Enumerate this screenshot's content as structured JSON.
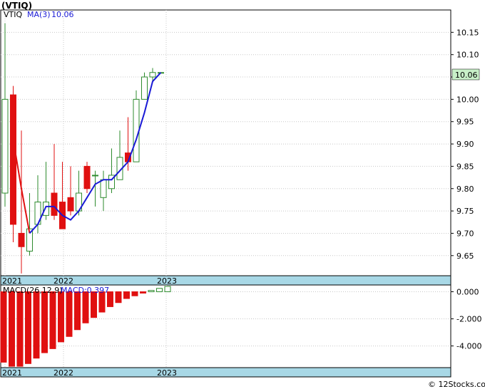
{
  "title": "(VTIQ)",
  "footer": "© 12Stocks.com",
  "colors": {
    "up": "#2e8b2e",
    "down": "#e01010",
    "ma": "#1a1ad6",
    "axis_band": "#a8d8e6",
    "last_price_bg": "#c8f0c8"
  },
  "chart_data": [
    {
      "type": "candlestick",
      "legend": {
        "ticker": "VTIQ",
        "ma_label": "MA(3)",
        "ma_value": "10.06"
      },
      "last_price_label": "10.06",
      "x_tick_labels": [
        "2021",
        "2022",
        "2023"
      ],
      "y_ticks": [
        "9.65",
        "9.70",
        "9.75",
        "9.80",
        "9.85",
        "9.90",
        "9.95",
        "10.00",
        "10.05",
        "10.10",
        "10.15"
      ],
      "ylim": [
        9.605,
        10.2
      ],
      "candles": [
        {
          "o": 9.79,
          "h": 10.17,
          "l": 9.76,
          "c": 10.0
        },
        {
          "o": 10.01,
          "h": 10.03,
          "l": 9.68,
          "c": 9.72
        },
        {
          "o": 9.7,
          "h": 9.93,
          "l": 9.61,
          "c": 9.67
        },
        {
          "o": 9.66,
          "h": 9.79,
          "l": 9.65,
          "c": 9.71
        },
        {
          "o": 9.72,
          "h": 9.83,
          "l": 9.7,
          "c": 9.77
        },
        {
          "o": 9.74,
          "h": 9.86,
          "l": 9.73,
          "c": 9.77
        },
        {
          "o": 9.79,
          "h": 9.9,
          "l": 9.73,
          "c": 9.74
        },
        {
          "o": 9.77,
          "h": 9.86,
          "l": 9.71,
          "c": 9.71
        },
        {
          "o": 9.78,
          "h": 9.85,
          "l": 9.74,
          "c": 9.75
        },
        {
          "o": 9.75,
          "h": 9.84,
          "l": 9.74,
          "c": 9.79
        },
        {
          "o": 9.85,
          "h": 9.86,
          "l": 9.79,
          "c": 9.8
        },
        {
          "o": 9.83,
          "h": 9.84,
          "l": 9.76,
          "c": 9.83
        },
        {
          "o": 9.78,
          "h": 9.84,
          "l": 9.75,
          "c": 9.82
        },
        {
          "o": 9.8,
          "h": 9.89,
          "l": 9.79,
          "c": 9.83
        },
        {
          "o": 9.82,
          "h": 9.93,
          "l": 9.82,
          "c": 9.87
        },
        {
          "o": 9.88,
          "h": 9.96,
          "l": 9.84,
          "c": 9.86
        },
        {
          "o": 9.86,
          "h": 10.02,
          "l": 9.86,
          "c": 10.0
        },
        {
          "o": 10.0,
          "h": 10.06,
          "l": 10.0,
          "c": 10.05
        },
        {
          "o": 10.05,
          "h": 10.07,
          "l": 10.04,
          "c": 10.06
        },
        {
          "o": 10.06,
          "h": 10.06,
          "l": 10.06,
          "c": 10.06
        }
      ],
      "ma": [
        null,
        9.91,
        9.8,
        9.7,
        9.72,
        9.76,
        9.76,
        9.74,
        9.73,
        9.75,
        9.78,
        9.81,
        9.82,
        9.82,
        9.84,
        9.86,
        9.91,
        9.97,
        10.04,
        10.06
      ]
    },
    {
      "type": "bar",
      "legend": {
        "label": "MACD(26,12,9)",
        "value_label": "MACD:0.397"
      },
      "y_ticks": [
        "0.000",
        "-2.000",
        "-4.000"
      ],
      "ylim": [
        -5.6,
        0.5
      ],
      "values": [
        -5.2,
        -5.5,
        -5.5,
        -5.3,
        -4.9,
        -4.5,
        -4.2,
        -3.7,
        -3.3,
        -2.8,
        -2.3,
        -1.9,
        -1.5,
        -1.1,
        -0.8,
        -0.5,
        -0.3,
        -0.1,
        0.1,
        0.25,
        0.397
      ]
    }
  ]
}
